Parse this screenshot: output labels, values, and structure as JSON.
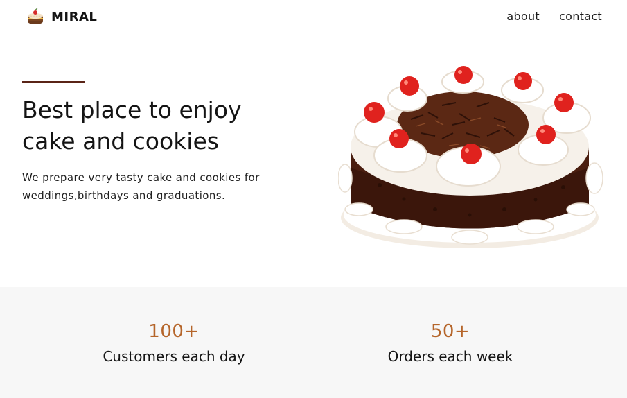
{
  "header": {
    "brand": {
      "icon": "cake-icon",
      "name": "MIRAL"
    },
    "nav": [
      {
        "label": "about"
      },
      {
        "label": "contact"
      }
    ]
  },
  "hero": {
    "title_line1": "Best place to enjoy",
    "title_line2": "cake and cookies",
    "subtitle": "We prepare very tasty cake and cookies for weddings,birthdays and graduations.",
    "image": "black-forest-cake-image",
    "accent_color": "#5a2417"
  },
  "stats": [
    {
      "value": "100+",
      "label": "Customers each day"
    },
    {
      "value": "50+",
      "label": "Orders each week"
    }
  ],
  "colors": {
    "stat_value": "#b5652a",
    "stats_background": "#f7f7f7"
  }
}
